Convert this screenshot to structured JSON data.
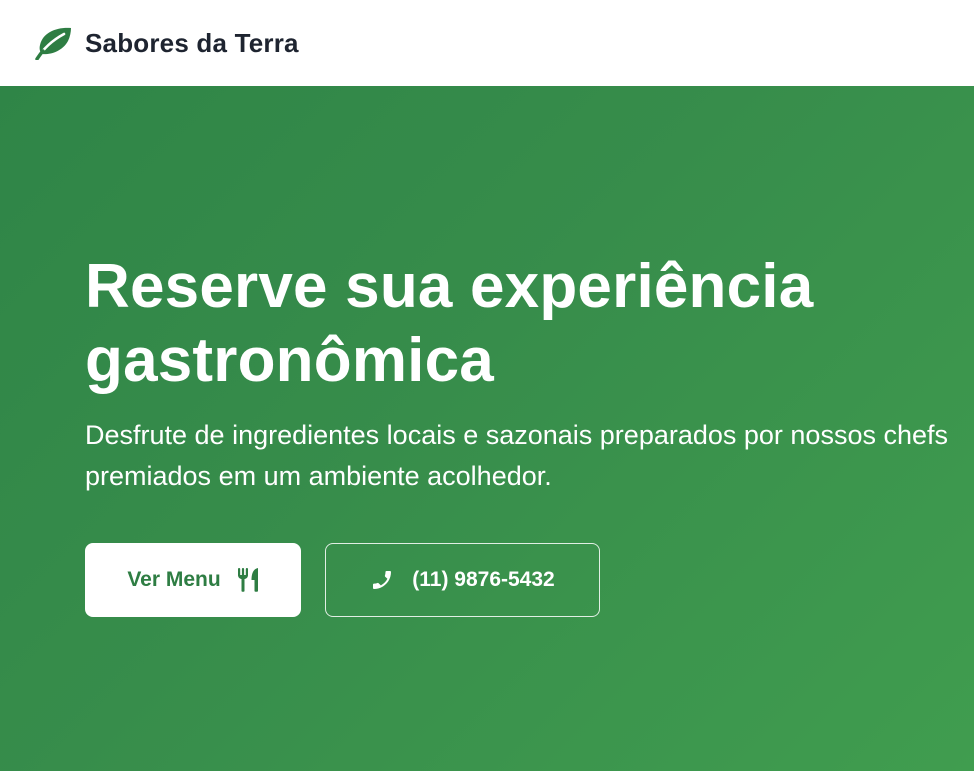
{
  "header": {
    "brand_icon": "leaf-icon",
    "brand_name": "Sabores da Terra"
  },
  "hero": {
    "title": "Reserve sua experiência gastronômica",
    "subtitle": "Desfrute de ingredientes locais e sazonais preparados por nossos chefs premiados em um ambiente acolhedor.",
    "primary_button": {
      "label": "Ver Menu",
      "icon": "utensils-icon"
    },
    "secondary_button": {
      "label": "(11) 9876-5432",
      "icon": "phone-icon"
    }
  },
  "colors": {
    "brand_green": "#2e7d43",
    "hero_gradient_start": "#2f8547",
    "hero_gradient_end": "#409d4f",
    "header_text": "#1e2430"
  }
}
